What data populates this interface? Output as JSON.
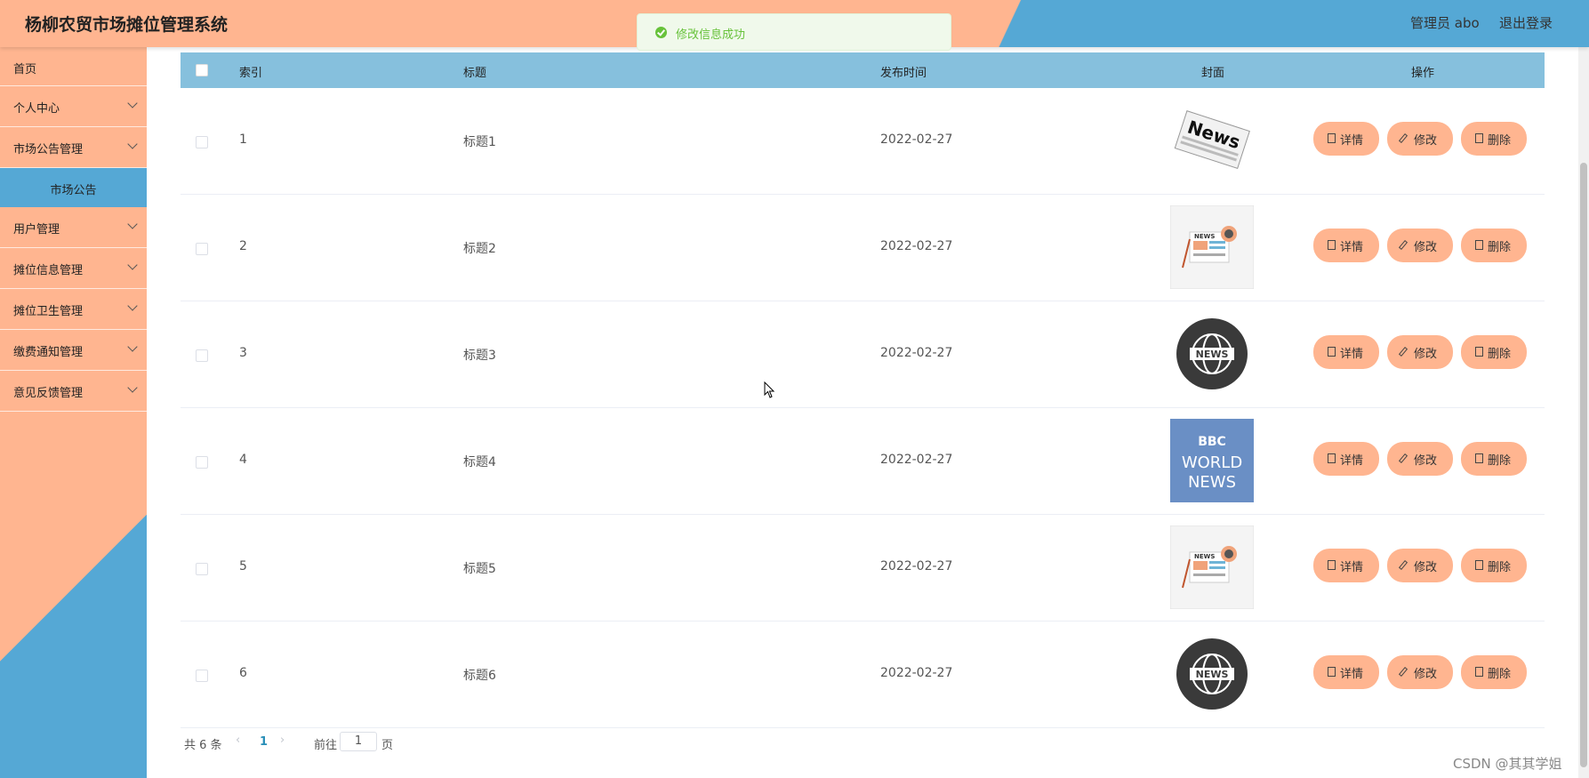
{
  "header": {
    "title": "杨柳农贸市场摊位管理系统",
    "user": "管理员 abo",
    "logout": "退出登录"
  },
  "toast": {
    "message": "修改信息成功"
  },
  "sidebar": {
    "home": "首页",
    "items": [
      {
        "label": "个人中心"
      },
      {
        "label": "市场公告管理"
      },
      {
        "label": "用户管理"
      },
      {
        "label": "摊位信息管理"
      },
      {
        "label": "摊位卫生管理"
      },
      {
        "label": "缴费通知管理"
      },
      {
        "label": "意见反馈管理"
      }
    ],
    "active_sub": "市场公告"
  },
  "table": {
    "headers": {
      "index": "索引",
      "title": "标题",
      "date": "发布时间",
      "cover": "封面",
      "ops": "操作"
    },
    "rows": [
      {
        "index": "1",
        "title": "标题1",
        "date": "2022-02-27",
        "cover": "news-paper"
      },
      {
        "index": "2",
        "title": "标题2",
        "date": "2022-02-27",
        "cover": "news-illustration"
      },
      {
        "index": "3",
        "title": "标题3",
        "date": "2022-02-27",
        "cover": "news-globe"
      },
      {
        "index": "4",
        "title": "标题4",
        "date": "2022-02-27",
        "cover": "bbc-world-news"
      },
      {
        "index": "5",
        "title": "标题5",
        "date": "2022-02-27",
        "cover": "news-illustration"
      },
      {
        "index": "6",
        "title": "标题6",
        "date": "2022-02-27",
        "cover": "news-globe"
      }
    ],
    "actions": {
      "detail": "详情",
      "edit": "修改",
      "delete": "删除"
    }
  },
  "covers": {
    "newspaper_text": "News",
    "globe_text": "NEWS",
    "illus_text": "NEWS",
    "bbc": {
      "line1": "BBC",
      "line2": "WORLD",
      "line3": "NEWS"
    }
  },
  "pagination": {
    "total": "共 6 条",
    "current": "1",
    "goto": "前往",
    "input": "1",
    "page": "页",
    "prev": "‹",
    "next": "›"
  },
  "watermark": "CSDN @其其学姐",
  "colors": {
    "accent_orange": "#ffb590",
    "accent_blue": "#55a8d5",
    "header_row": "#86c0dd",
    "success": "#67c23a"
  }
}
